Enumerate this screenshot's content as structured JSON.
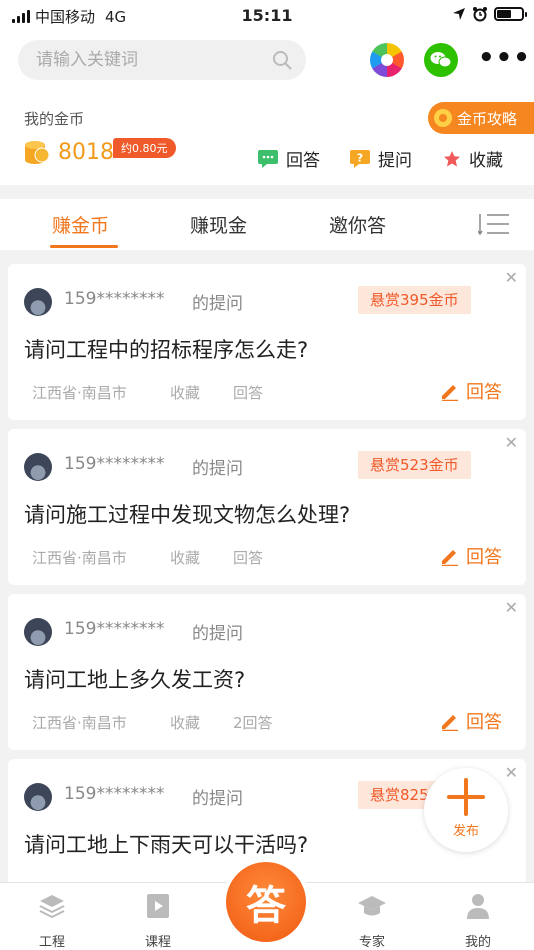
{
  "status_bar": {
    "carrier": "中国移动",
    "network": "4G",
    "time": "15:11"
  },
  "search": {
    "placeholder": "请输入关键词"
  },
  "header_icons": [
    "pinwheel-icon",
    "wechat-icon",
    "more-icon"
  ],
  "coins": {
    "label": "我的金币",
    "amount": "8018",
    "approx": "约0.80元",
    "strategy_label": "金币攻略",
    "quick_actions": [
      {
        "label": "回答",
        "icon": "chat-icon"
      },
      {
        "label": "提问",
        "icon": "question-icon"
      },
      {
        "label": "收藏",
        "icon": "star-icon"
      }
    ]
  },
  "tabs": [
    {
      "label": "赚金币",
      "active": true
    },
    {
      "label": "赚现金",
      "active": false
    },
    {
      "label": "邀你答",
      "active": false
    }
  ],
  "cards": [
    {
      "user": "159********",
      "asked": "的提问",
      "reward": "悬赏395金币",
      "question": "请问工程中的招标程序怎么走?",
      "location": "江西省·南昌市",
      "favorite": "收藏",
      "answers": "回答",
      "answer_button": "回答"
    },
    {
      "user": "159********",
      "asked": "的提问",
      "reward": "悬赏523金币",
      "question": "请问施工过程中发现文物怎么处理?",
      "location": "江西省·南昌市",
      "favorite": "收藏",
      "answers": "回答",
      "answer_button": "回答"
    },
    {
      "user": "159********",
      "asked": "的提问",
      "reward": "",
      "question": "请问工地上多久发工资?",
      "location": "江西省·南昌市",
      "favorite": "收藏",
      "answers": "2回答",
      "answer_button": "回答"
    },
    {
      "user": "159********",
      "asked": "的提问",
      "reward": "悬赏825",
      "question": "请问工地上下雨天可以干活吗?",
      "location": "",
      "favorite": "",
      "answers": "",
      "answer_button": ""
    }
  ],
  "publish": {
    "label": "发布"
  },
  "bottom_nav": [
    {
      "label": "工程",
      "icon": "layers-icon"
    },
    {
      "label": "课程",
      "icon": "video-icon"
    },
    {
      "label": "答",
      "icon": "answer-logo"
    },
    {
      "label": "专家",
      "icon": "graduation-cap-icon"
    },
    {
      "label": "我的",
      "icon": "person-icon"
    }
  ],
  "colors": {
    "accent": "#f2761c",
    "reward_bg": "#fde6da",
    "reward_text": "#f05a2a",
    "coin": "#f29a1b"
  }
}
